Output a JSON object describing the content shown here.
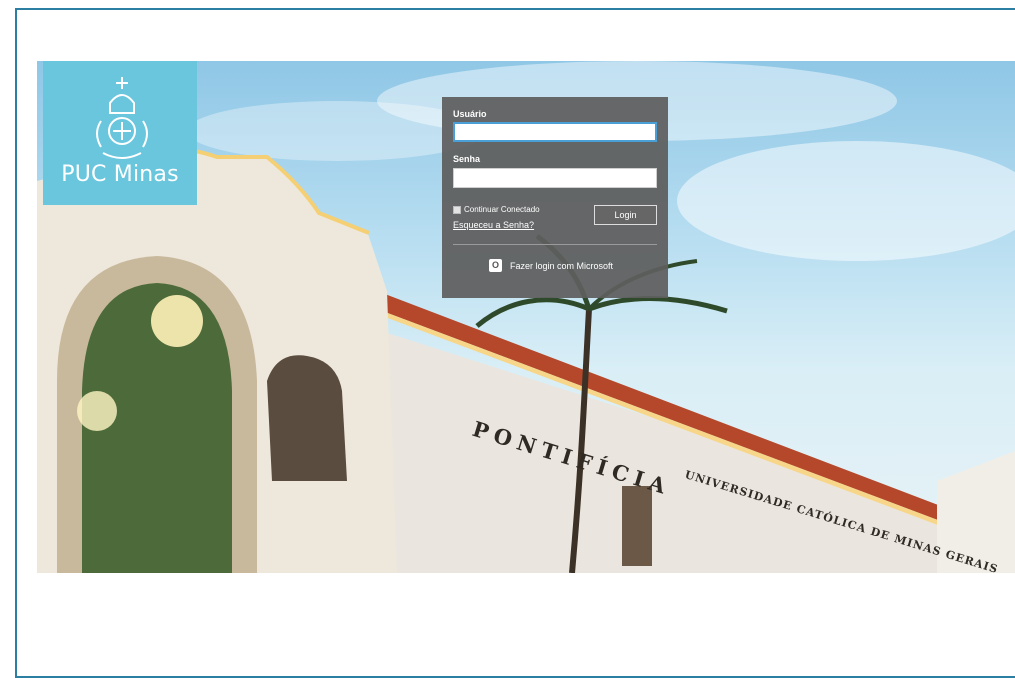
{
  "logo": {
    "text": "PUC Minas",
    "color": "#69c6dd"
  },
  "hero": {
    "inscription_line1": "PONTIFÍCIA",
    "inscription_line2": "UNIVERSIDADE CATÓLICA DE MINAS GERAIS"
  },
  "login": {
    "username_label": "Usuário",
    "username_value": "",
    "password_label": "Senha",
    "password_value": "",
    "remember_label": "Continuar Conectado",
    "forgot_link": "Esqueceu a Senha?",
    "login_button": "Login",
    "microsoft_button": "Fazer login com Microsoft",
    "microsoft_icon": "office-icon"
  },
  "colors": {
    "accent_border": "#2b7fa3",
    "panel": "#5f5f5f",
    "focus": "#4a9fd6"
  }
}
